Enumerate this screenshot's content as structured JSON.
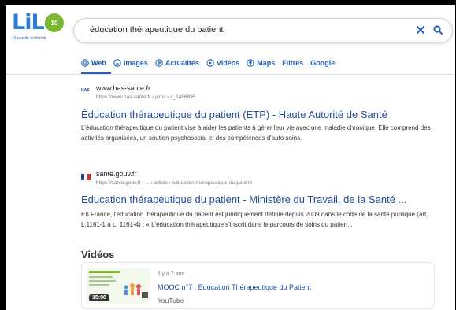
{
  "logo": {
    "text": "LiLo",
    "badge": "10",
    "subtitle": "10 ans de solidarité"
  },
  "search": {
    "query": "éducation thérapeutique du patient"
  },
  "tabs": [
    {
      "label": "Web",
      "icon": "search-icon",
      "active": true
    },
    {
      "label": "Images",
      "icon": "image-icon"
    },
    {
      "label": "Actualités",
      "icon": "news-icon"
    },
    {
      "label": "Vidéos",
      "icon": "play-icon"
    },
    {
      "label": "Maps",
      "icon": "map-pin-icon"
    },
    {
      "label": "Filtres"
    },
    {
      "label": "Google"
    }
  ],
  "results": [
    {
      "favicon": "HAS",
      "domain": "www.has-sante.fr",
      "url": "https://www.has-sante.fr › jcms › c_1496895",
      "title": "Éducation thérapeutique du patient (ETP) - Haute Autorité de Santé",
      "snippet": "L'éducation thérapeutique du patient vise à aider les patients à gérer leur vie avec une maladie chronique. Elle comprend des activités organisées, un soutien psychosocial et des compétences d'auto soins."
    },
    {
      "favicon": "flag-fr",
      "domain": "sante.gouv.fr",
      "url": "https://sante.gouv.fr › ... › article › education-therapeutique-du-patient",
      "title": "Education thérapeutique du patient - Ministère du Travail, de la Santé ...",
      "snippet": "En France, l'éducation thérapeutique du patient est juridiquement définie depuis 2009 dans le code de la santé publique (art. L.1161-1 à L. 1161-4) : « L'éducation thérapeutique s'inscrit dans le parcours de soins du patien..."
    }
  ],
  "videos": {
    "heading": "Vidéos",
    "items": [
      {
        "age": "Il y a 7 ans",
        "title": "MOOC n°7 : Education Thérapeutique du Patient",
        "source": "YouTube",
        "duration": "15:08"
      }
    ]
  },
  "colors": {
    "accent": "#2563b8",
    "title_link": "#234d9c",
    "logo_blue": "#2f7fd4",
    "logo_green": "#7cb82f"
  }
}
